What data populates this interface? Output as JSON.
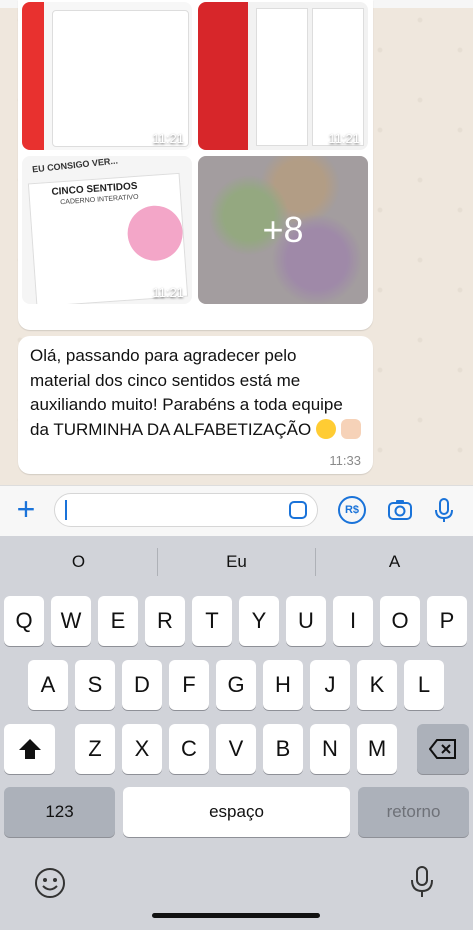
{
  "chat": {
    "media": {
      "thumb_times": [
        "11:21",
        "11:21",
        "11:21"
      ],
      "more_count": "+8",
      "thumb3_texts": [
        "EU CONSIGO VER...",
        "CINCO SENTIDOS",
        "CADERNO INTERATIVO"
      ]
    },
    "message": {
      "text": "Olá, passando para agradecer pelo material dos cinco sentidos  está me auxiliando muito! Parabéns a toda equipe da TURMINHA DA ALFABETIZAÇÃO",
      "time": "11:33"
    }
  },
  "input": {
    "plus_label": "+",
    "currency_label": "R$"
  },
  "keyboard": {
    "suggestions": [
      "O",
      "Eu",
      "A"
    ],
    "row1": [
      "Q",
      "W",
      "E",
      "R",
      "T",
      "Y",
      "U",
      "I",
      "O",
      "P"
    ],
    "row2": [
      "A",
      "S",
      "D",
      "F",
      "G",
      "H",
      "J",
      "K",
      "L"
    ],
    "row3": [
      "Z",
      "X",
      "C",
      "V",
      "B",
      "N",
      "M"
    ],
    "numbers_label": "123",
    "space_label": "espaço",
    "return_label": "retorno"
  }
}
